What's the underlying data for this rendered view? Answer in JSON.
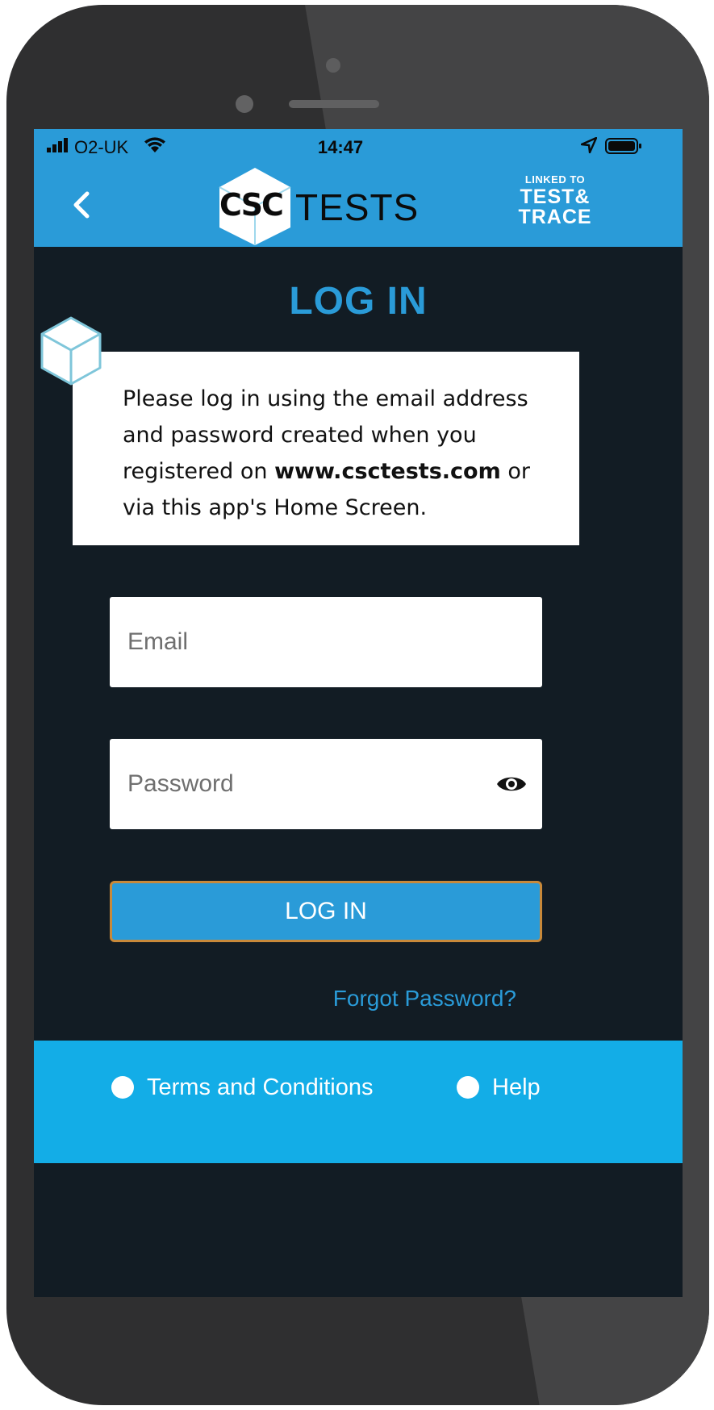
{
  "status_bar": {
    "carrier": "O2-UK",
    "time": "14:47"
  },
  "header": {
    "logo_csc": "CSC",
    "logo_tests": "TESTS",
    "badge_line1": "LINKED TO",
    "badge_line2": "TEST&",
    "badge_line3": "TRACE"
  },
  "page": {
    "title": "LOG IN"
  },
  "info": {
    "text_before": "Please log in using the email address and password created when you registered on ",
    "link_text": "www.csctests.com",
    "text_after": " or via this app's Home Screen."
  },
  "form": {
    "email_placeholder": "Email",
    "email_value": "",
    "password_placeholder": "Password",
    "password_value": "",
    "login_label": "LOG IN",
    "forgot_label": "Forgot Password?"
  },
  "footer": {
    "terms_label": "Terms and Conditions",
    "help_label": "Help"
  },
  "icons": {
    "back": "chevron-left-icon",
    "eye": "eye-icon",
    "signal": "signal-icon",
    "wifi": "wifi-icon",
    "location": "location-arrow-icon",
    "battery": "battery-icon"
  },
  "colors": {
    "accent_blue": "#2a9bd8",
    "footer_blue": "#13ade7",
    "screen_bg": "#121c24",
    "button_border": "#c8893a"
  }
}
